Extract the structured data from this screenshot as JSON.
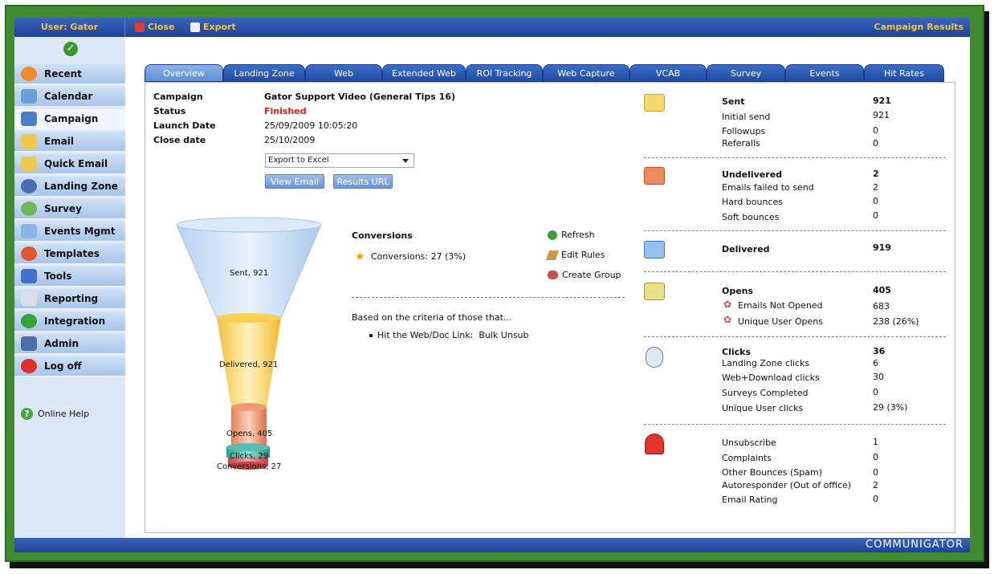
{
  "topbar": {
    "user": "User: Gator",
    "close": "Close",
    "export": "Export",
    "title": "Campaign Results"
  },
  "sidebar": {
    "items": [
      {
        "label": "Recent",
        "icon": "recent-icon"
      },
      {
        "label": "Calendar",
        "icon": "calendar-icon"
      },
      {
        "label": "Campaign",
        "icon": "campaign-icon"
      },
      {
        "label": "Email",
        "icon": "email-icon"
      },
      {
        "label": "Quick Email",
        "icon": "quick-email-icon"
      },
      {
        "label": "Landing Zone",
        "icon": "landing-zone-icon"
      },
      {
        "label": "Survey",
        "icon": "survey-icon"
      },
      {
        "label": "Events Mgmt",
        "icon": "events-icon"
      },
      {
        "label": "Templates",
        "icon": "templates-icon"
      },
      {
        "label": "Tools",
        "icon": "tools-icon"
      },
      {
        "label": "Reporting",
        "icon": "reporting-icon"
      },
      {
        "label": "Integration",
        "icon": "integration-icon"
      },
      {
        "label": "Admin",
        "icon": "admin-icon"
      },
      {
        "label": "Log off",
        "icon": "log-off-icon"
      }
    ],
    "help": "Online Help"
  },
  "tabs": [
    "Overview",
    "Landing Zone",
    "Web",
    "Extended Web",
    "ROI Tracking",
    "Web Capture",
    "VCAB",
    "Survey",
    "Events",
    "Hit Rates"
  ],
  "campaign": {
    "campaign_label": "Campaign",
    "campaign_value": "Gator Support Video (General Tips 16)",
    "status_label": "Status",
    "status_value": "Finished",
    "launch_label": "Launch Date",
    "launch_value": "25/09/2009 10:05:20",
    "close_label": "Close date",
    "close_value": "25/10/2009",
    "export_select": "Export to Excel",
    "view_email": "View Email",
    "results_url": "Results URL"
  },
  "funnel": {
    "sent": "Sent, 921",
    "delivered": "Delivered, 921",
    "opens": "Opens, 405",
    "clicks": "Clicks, 29",
    "conversions": "Conversions, 27"
  },
  "conversions": {
    "title": "Conversions",
    "line": "Conversions: 27 (3%)",
    "refresh": "Refresh",
    "edit_rules": "Edit Rules",
    "create_group": "Create Group",
    "criteria": "Based on the criteria of those that...",
    "bullet": "Hit the Web/Doc Link:",
    "bullet_value": "Bulk Unsub"
  },
  "stats": {
    "sent": {
      "title": "Sent",
      "total": "921",
      "rows": [
        [
          "Initial send",
          "921"
        ],
        [
          "Followups",
          "0"
        ],
        [
          "Referalls",
          "0"
        ]
      ]
    },
    "undelivered": {
      "title": "Undelivered",
      "total": "2",
      "rows": [
        [
          "Emails failed to send",
          "2"
        ],
        [
          "Hard bounces",
          "0"
        ],
        [
          "Soft bounces",
          "0"
        ]
      ]
    },
    "delivered": {
      "title": "Delivered",
      "total": "919"
    },
    "opens": {
      "title": "Opens",
      "total": "405",
      "rows": [
        [
          "Emails Not Opened",
          "683"
        ],
        [
          "Unique User Opens",
          "238 (26%)"
        ]
      ]
    },
    "clicks": {
      "title": "Clicks",
      "total": "36",
      "rows": [
        [
          "Landing Zone clicks",
          "6"
        ],
        [
          "Web+Download clicks",
          "30"
        ],
        [
          "Surveys Completed",
          "0"
        ],
        [
          "Unique User clicks",
          "29 (3%)"
        ]
      ]
    },
    "other": {
      "rows": [
        [
          "Unsubscribe",
          "1"
        ],
        [
          "Complaints",
          "0"
        ],
        [
          "Other Bounces (Spam)",
          "0"
        ],
        [
          "Autoresponder (Out of office)",
          "2"
        ],
        [
          "Email Rating",
          "0"
        ]
      ]
    }
  },
  "brand": "COMMUNIGATOR",
  "colors": {
    "accent": "#1e439a",
    "frame": "#3f8a2e",
    "status": "#e01d1d",
    "highlight": "#f5c542"
  }
}
